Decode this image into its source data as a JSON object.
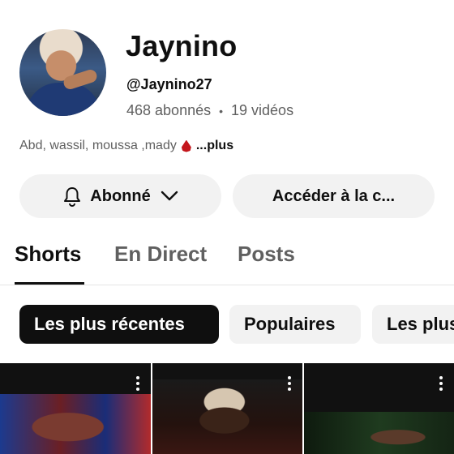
{
  "channel": {
    "name": "Jaynino",
    "handle": "@Jaynino27",
    "subscribers": "468 abonnés",
    "separator": "•",
    "videos": "19 vidéos",
    "description": "Abd, wassil, moussa ,mady",
    "more_label": "...plus"
  },
  "actions": {
    "subscribed_label": "Abonné",
    "access_label": "Accéder à la c..."
  },
  "tabs": [
    {
      "label": "Shorts",
      "active": true
    },
    {
      "label": "En Direct",
      "active": false
    },
    {
      "label": "Posts",
      "active": false
    }
  ],
  "filters": [
    {
      "label": "Les plus récentes",
      "active": true
    },
    {
      "label": "Populaires",
      "active": false
    },
    {
      "label": "Les plus",
      "active": false
    }
  ],
  "icons": {
    "bell": "bell-icon",
    "chevron": "chevron-down-icon",
    "blood_drop": "drop-emoji",
    "more": "more-vert-icon"
  }
}
